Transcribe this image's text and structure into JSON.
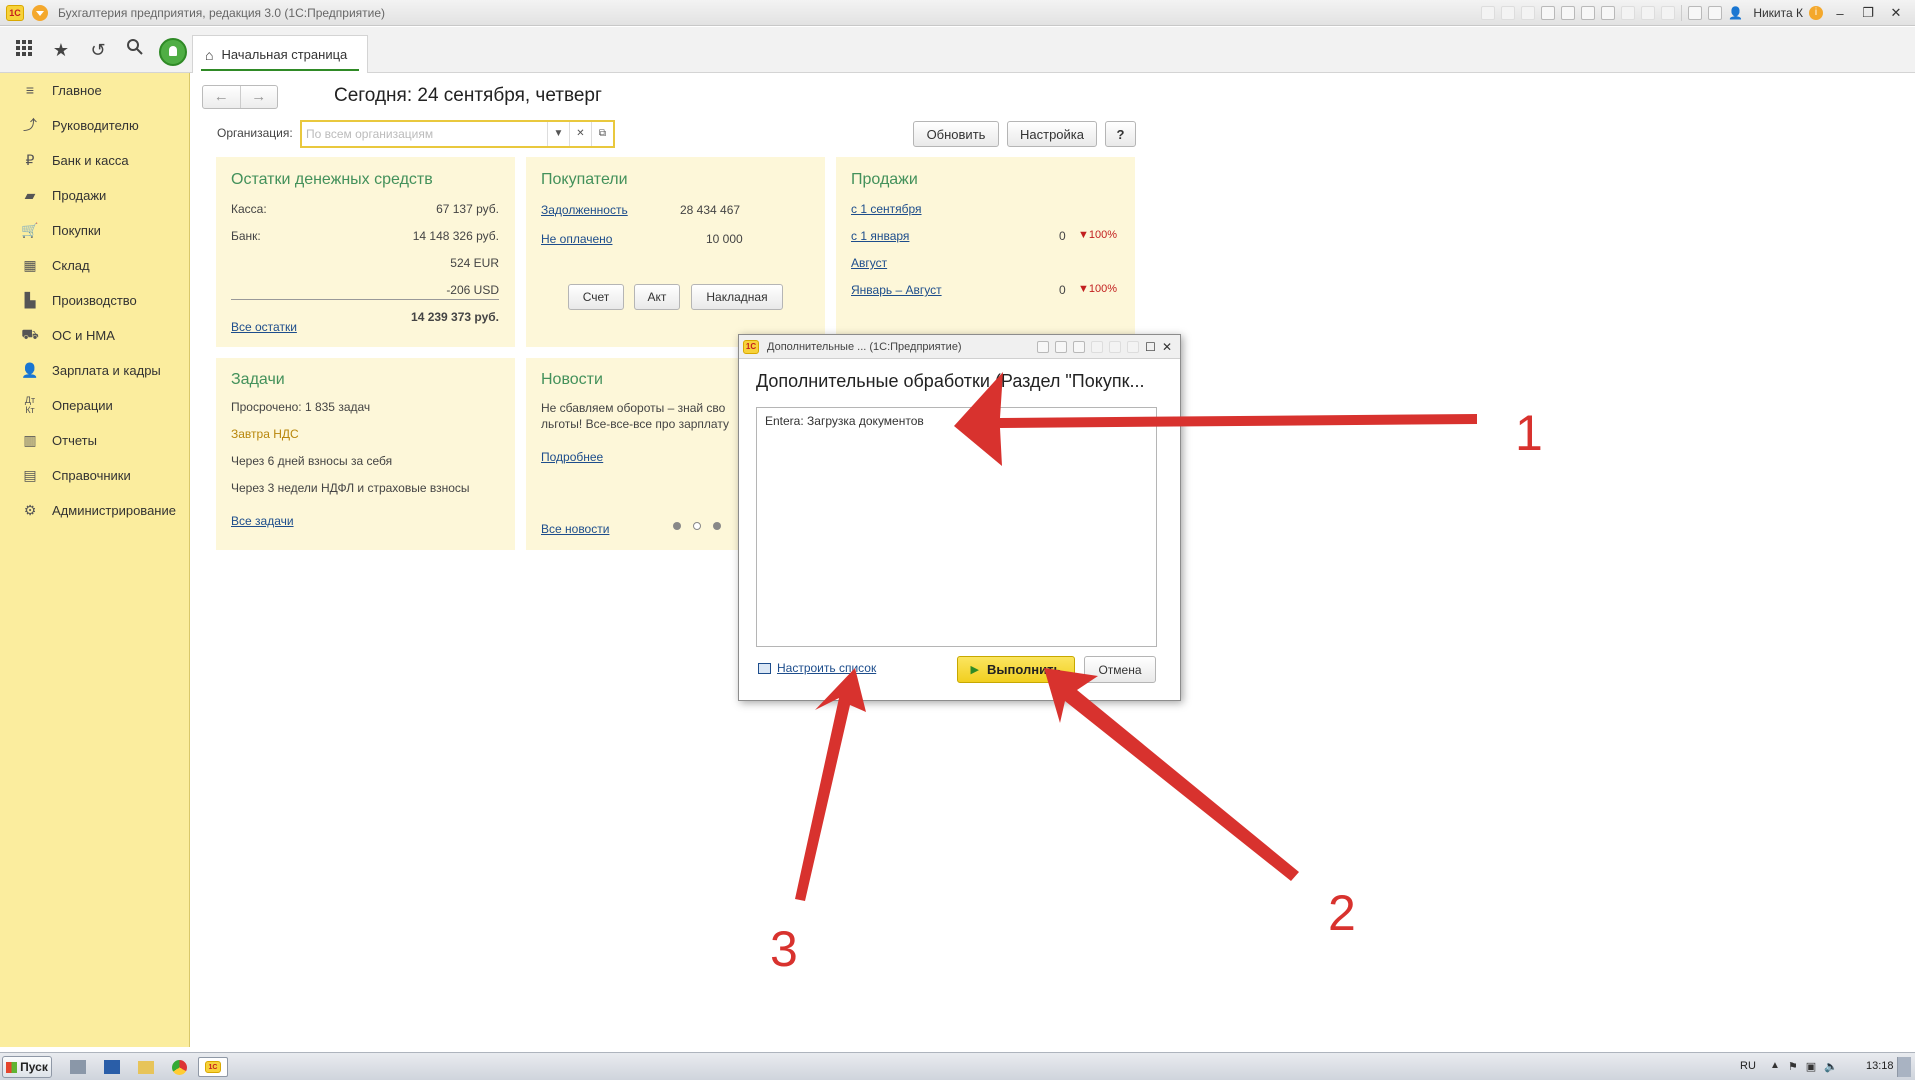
{
  "window": {
    "title": "Бухгалтерия предприятия, редакция 3.0  (1С:Предприятие)",
    "user": "Никита К"
  },
  "tabs": [
    {
      "label": "Начальная страница"
    }
  ],
  "sidebar": {
    "items": [
      {
        "label": "Главное",
        "icon": "menu-lines-icon"
      },
      {
        "label": "Руководителю",
        "icon": "trend-icon"
      },
      {
        "label": "Банк и касса",
        "icon": "ruble-icon"
      },
      {
        "label": "Продажи",
        "icon": "bag-icon"
      },
      {
        "label": "Покупки",
        "icon": "cart-icon"
      },
      {
        "label": "Склад",
        "icon": "grid-icon"
      },
      {
        "label": "Производство",
        "icon": "factory-icon"
      },
      {
        "label": "ОС и НМА",
        "icon": "truck-icon"
      },
      {
        "label": "Зарплата и кадры",
        "icon": "person-icon"
      },
      {
        "label": "Операции",
        "icon": "dt-kt-icon"
      },
      {
        "label": "Отчеты",
        "icon": "bar-chart-icon"
      },
      {
        "label": "Справочники",
        "icon": "book-icon"
      },
      {
        "label": "Администрирование",
        "icon": "gear-icon"
      }
    ]
  },
  "main": {
    "today": "Сегодня: 24 сентября, четверг",
    "org_label": "Организация:",
    "org_placeholder": "По всем организациям",
    "refresh": "Обновить",
    "settings": "Настройка",
    "help": "?",
    "cash": {
      "title": "Остатки денежных средств",
      "kassa_label": "Касса:",
      "kassa_value": "67 137 руб.",
      "bank_label": "Банк:",
      "bank_value": "14 148 326 руб.",
      "eur_value": "524 EUR",
      "usd_value": "-206 USD",
      "total": "14 239 373 руб.",
      "all_link": "Все остатки"
    },
    "buyers": {
      "title": "Покупатели",
      "debt_label": "Задолженность",
      "debt_value": "28 434 467",
      "unpaid_label": "Не оплачено",
      "unpaid_value": "10 000",
      "btn_invoice": "Счет",
      "btn_act": "Акт",
      "btn_waybill": "Накладная"
    },
    "sales": {
      "title": "Продажи",
      "rows": [
        {
          "label": "с 1 сентября",
          "value": "",
          "change": ""
        },
        {
          "label": "с 1 января",
          "value": "0",
          "change": "▼100%"
        },
        {
          "label": "Август",
          "value": "",
          "change": ""
        },
        {
          "label": "Январь – Август",
          "value": "0",
          "change": "▼100%"
        }
      ]
    },
    "tasks": {
      "title": "Задачи",
      "overdue": "Просрочено: 1 835 задач",
      "tomorrow": "Завтра НДС",
      "in6days": "Через 6 дней взносы за себя",
      "in3weeks": "Через 3 недели НДФЛ и страховые взносы",
      "all_link": "Все задачи"
    },
    "news": {
      "title": "Новости",
      "line1": "Не сбавляем обороты – знай сво",
      "line2": "льготы! Все-все-все про зарплату",
      "more_link": "Подробнее",
      "all_link": "Все новости"
    }
  },
  "dialog": {
    "window_title": "Дополнительные ... (1С:Предприятие)",
    "heading": "Дополнительные обработки (Раздел \"Покупк...",
    "list_item": "Entera: Загрузка документов",
    "configure_link": "Настроить список",
    "run_button": "Выполнить",
    "cancel_button": "Отмена"
  },
  "annotations": [
    "1",
    "2",
    "3"
  ],
  "taskbar": {
    "start": "Пуск",
    "lang": "RU",
    "time": "13:18"
  },
  "colors": {
    "sidebar_bg": "#fbed9e",
    "panel_bg": "#fdf7d9",
    "title_green": "#43915b",
    "link_blue": "#1d4d8c",
    "annotation_red": "#d8322e",
    "run_button_yellow": "#f1cf1f"
  }
}
